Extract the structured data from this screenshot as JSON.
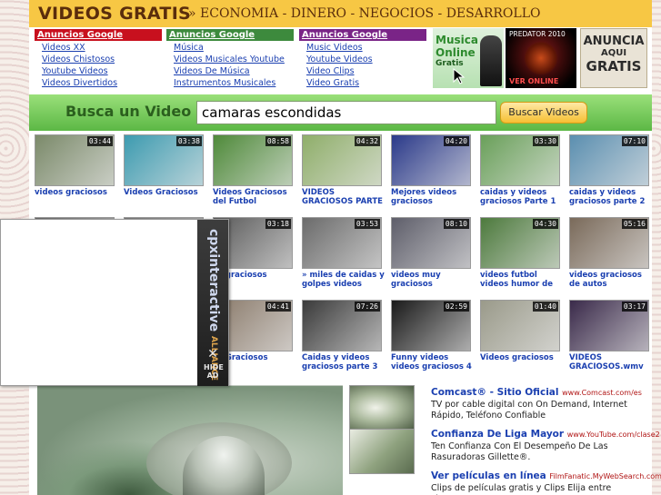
{
  "header": {
    "brand": "VIDEOS GRATIS",
    "tagline": "» ECONOMIA - DINERO - NEGOCIOS - DESARROLLO"
  },
  "ad_columns": [
    {
      "heading": "Anuncios Google",
      "links": [
        "Videos XX",
        "Videos Chistosos",
        "Youtube Videos",
        "Videos Divertidos"
      ]
    },
    {
      "heading": "Anuncios Google",
      "links": [
        "Música",
        "Videos Musicales Youtube",
        "Videos De Música",
        "Instrumentos Musicales"
      ]
    },
    {
      "heading": "Anuncios Google",
      "links": [
        "Music Videos",
        "Youtube Videos",
        "Video Clips",
        "Video Gratis"
      ]
    }
  ],
  "banners": {
    "musica": {
      "line1": "Musica",
      "line2": "Online",
      "line3": "Gratis"
    },
    "predator": {
      "top": "PREDATOR 2010",
      "bottom": "VER ONLINE"
    },
    "anuncia": {
      "line1": "ANUNCIA",
      "line2": "AQUI",
      "line3": "GRATIS"
    }
  },
  "search": {
    "label": "Busca un Video",
    "value": "camaras escondidas",
    "button": "Buscar Videos"
  },
  "videos": [
    {
      "duration": "03:44",
      "title": "videos graciosos",
      "color": "#7b8a6a"
    },
    {
      "duration": "03:38",
      "title": "Videos Graciosos",
      "color": "#3d9bb0"
    },
    {
      "duration": "08:58",
      "title": "Videos Graciosos del Futbol",
      "color": "#4f8a3a"
    },
    {
      "duration": "04:32",
      "title": "VIDEOS GRACIOSOS PARTE",
      "color": "#8fae6a"
    },
    {
      "duration": "04:20",
      "title": "Mejores videos graciosos",
      "color": "#2b3a8a"
    },
    {
      "duration": "03:30",
      "title": "caidas y videos graciosos Parte 1",
      "color": "#6aa05a"
    },
    {
      "duration": "07:10",
      "title": "caidas y videos graciosos parte 2",
      "color": "#5b8fb0"
    },
    {
      "duration": "",
      "title": "",
      "color": "#6a6a6a"
    },
    {
      "duration": "",
      "title": "",
      "color": "#7a7a7a"
    },
    {
      "duration": "03:18",
      "title": "os graciosos",
      "color": "#5a5a5a"
    },
    {
      "duration": "03:53",
      "title": "» miles de caidas y golpes videos",
      "color": "#6b6b6b"
    },
    {
      "duration": "08:10",
      "title": "videos muy graciosos",
      "color": "#5e5e6a"
    },
    {
      "duration": "04:30",
      "title": "videos futbol videos humor de",
      "color": "#4d7a3d"
    },
    {
      "duration": "05:16",
      "title": "videos graciosos de autos",
      "color": "#7a6a5a"
    },
    {
      "duration": "",
      "title": "",
      "color": "#6a6a6a"
    },
    {
      "duration": "",
      "title": "",
      "color": "#6a6a6a"
    },
    {
      "duration": "04:41",
      "title": "os Graciosos",
      "color": "#8a7a6a"
    },
    {
      "duration": "07:26",
      "title": "Caidas y videos graciosos parte 3",
      "color": "#3a3a3a"
    },
    {
      "duration": "02:59",
      "title": "Funny videos videos graciosos 4",
      "color": "#1a1a1a"
    },
    {
      "duration": "01:40",
      "title": "Videos graciosos",
      "color": "#9a9a8a"
    },
    {
      "duration": "03:17",
      "title": "VIDEOS GRACIOSOS.wmv",
      "color": "#3a2a4a"
    }
  ],
  "overlay_ad": {
    "logo": "cpx",
    "logo2": "interactive",
    "sub": "ALLIANCE",
    "close": "✕",
    "hide_line1": "HIDE",
    "hide_line2": "AD"
  },
  "text_ads": [
    {
      "title": "Comcast® - Sitio Oficial",
      "url": "www.Comcast.com/es",
      "desc": "TV por cable digital con On Demand, Internet Rápido, Teléfono Confiable"
    },
    {
      "title": "Confianza De Liga Mayor",
      "url": "www.YouTube.com/clase2",
      "desc": "Ten Confianza Con El Desempeño De Las Rasuradoras Gillette®."
    },
    {
      "title": "Ver películas en línea",
      "url": "FilmFanatic.MyWebSearch.com",
      "desc": "Clips de películas gratis y Clips Elija entre cientos"
    }
  ]
}
